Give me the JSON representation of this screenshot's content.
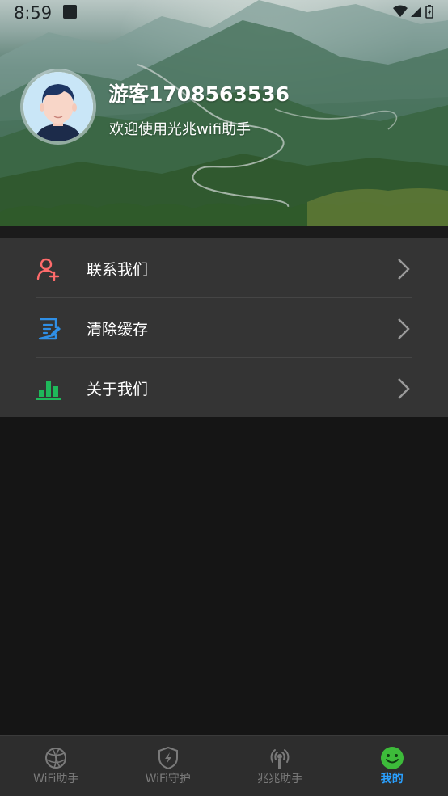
{
  "status_bar": {
    "time": "8:59"
  },
  "profile": {
    "username": "游客1708563536",
    "welcome": "欢迎使用光兆wifi助手"
  },
  "menu": {
    "items": [
      {
        "label": "联系我们",
        "icon": "contact-add-user-icon",
        "color": "#ff6b6b"
      },
      {
        "label": "清除缓存",
        "icon": "edit-document-icon",
        "color": "#2f8fe6"
      },
      {
        "label": "关于我们",
        "icon": "bar-chart-icon",
        "color": "#1fb85a"
      }
    ]
  },
  "bottom_nav": {
    "items": [
      {
        "label": "WiFi助手",
        "icon": "globe-icon",
        "active": false
      },
      {
        "label": "WiFi守护",
        "icon": "shield-lightning-icon",
        "active": false
      },
      {
        "label": "兆兆助手",
        "icon": "signal-antenna-icon",
        "active": false
      },
      {
        "label": "我的",
        "icon": "smiley-face-icon",
        "active": true
      }
    ]
  },
  "colors": {
    "accent": "#2aa0ff",
    "background": "#151515",
    "menu_background": "#343434",
    "nav_background": "#2d2d2d"
  }
}
